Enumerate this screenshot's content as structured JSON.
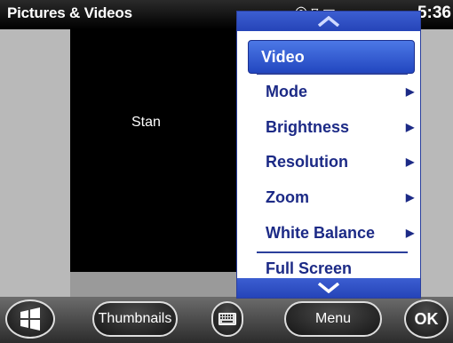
{
  "titlebar": {
    "title": "Pictures & Videos",
    "clock": "5:36",
    "status_icons": [
      "gps-icon",
      "signal-icon",
      "battery-icon"
    ]
  },
  "viewer": {
    "status_text": "Stan"
  },
  "menu": {
    "items": [
      {
        "label": "Video",
        "submenu": false,
        "selected": true
      },
      {
        "label": "Mode",
        "submenu": true
      },
      {
        "label": "Brightness",
        "submenu": true
      },
      {
        "label": "Resolution",
        "submenu": true
      },
      {
        "label": "Zoom",
        "submenu": true
      },
      {
        "label": "White Balance",
        "submenu": true
      },
      {
        "label": "Full Screen",
        "submenu": false
      }
    ]
  },
  "toolbar": {
    "thumbnails_label": "Thumbnails",
    "menu_label": "Menu",
    "ok_label": "OK"
  },
  "colors": {
    "menu_accent": "#2544b8",
    "menu_text": "#1c2a86"
  }
}
